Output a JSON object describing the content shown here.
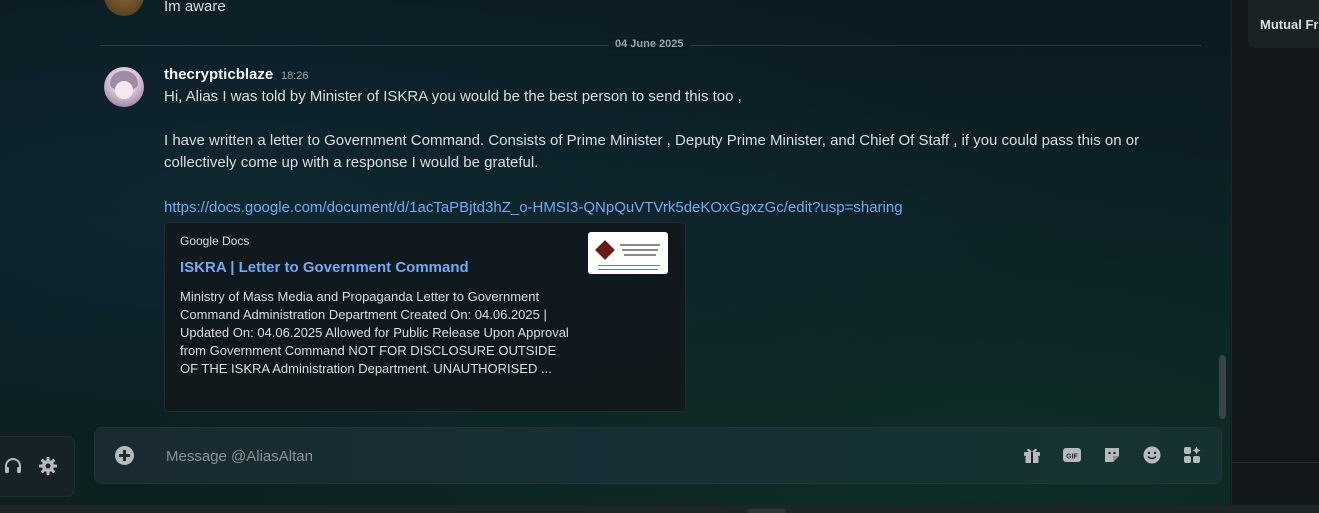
{
  "previous_message": {
    "text": "Im aware"
  },
  "date_divider": "04 June 2025",
  "message": {
    "author": "thecrypticblaze",
    "timestamp": "18:26",
    "lines": [
      "Hi, Alias I was told by Minister of ISKRA you would be the best person to send this too ,",
      "I have written a letter to Government Command. Consists of Prime Minister , Deputy Prime Minister, and Chief Of Staff , if you could pass this on or",
      "collectively come up with a response I would be grateful."
    ],
    "link": "https://docs.google.com/document/d/1acTaPBjtd3hZ_o-HMSI3-QNpQuVTVrk5deKOxGgxzGc/edit?usp=sharing",
    "embed": {
      "provider": "Google Docs",
      "title": "ISKRA | Letter to Government Command",
      "description": "Ministry of Mass Media and Propaganda Letter to Government Command Administration Department Created On: 04.06.2025 | Updated On: 04.06.2025 Allowed for Public Release Upon Approval from Government Command NOT FOR DISCLOSURE OUTSIDE OF THE ISKRA Administration Department. UNAUTHORISED ..."
    }
  },
  "composer": {
    "placeholder": "Message @AliasAltan",
    "icons": [
      "gift-icon",
      "gif-icon",
      "sticker-icon",
      "emoji-icon",
      "apps-icon"
    ]
  },
  "right_panel": {
    "section_label": "Mutual Fri"
  },
  "colors": {
    "link": "#6eaaf5",
    "text": "#dbdee1",
    "muted": "#9aa3a8"
  }
}
